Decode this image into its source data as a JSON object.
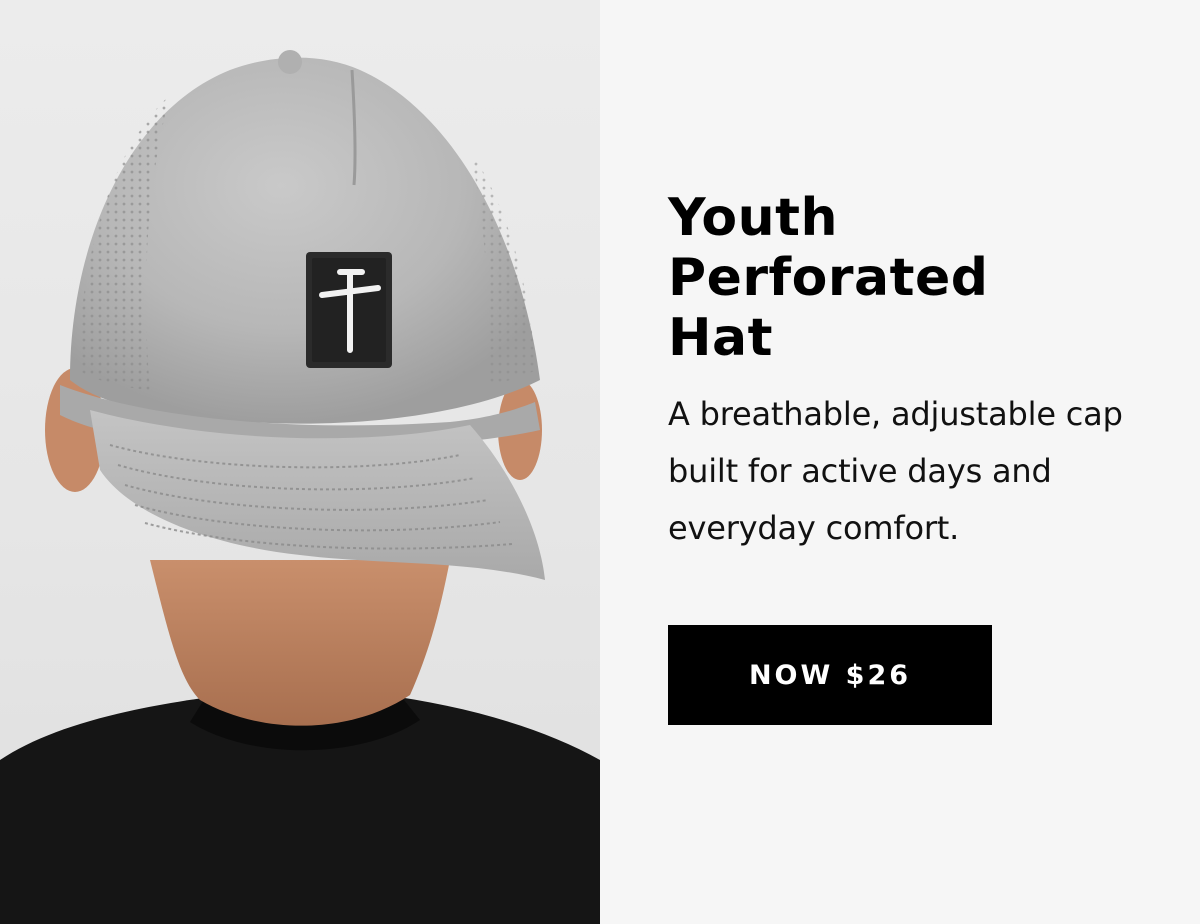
{
  "product": {
    "title_lines": [
      "Youth",
      "Perforated",
      "Hat"
    ],
    "description": "A breathable, adjustable cap built for active days and everyday comfort.",
    "cta_label": "NOW $26",
    "image_subject": "hat-photo"
  },
  "colors": {
    "background": "#f6f6f6",
    "cta_background": "#000000",
    "cta_text": "#ffffff",
    "cap": "#b9b9b9",
    "shirt": "#141414"
  }
}
